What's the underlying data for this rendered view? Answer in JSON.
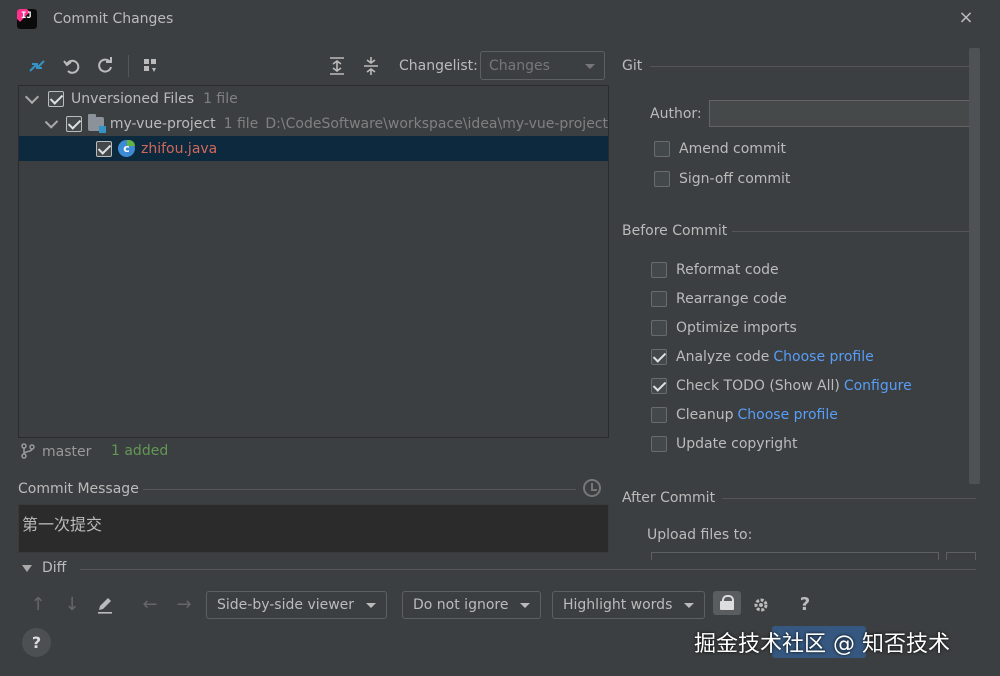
{
  "window": {
    "title": "Commit Changes",
    "close": "×"
  },
  "toolbar": {
    "changelist_label": "Changelist:",
    "changelist_value": "Changes"
  },
  "tree": {
    "root": {
      "label": "Unversioned Files",
      "count": "1 file"
    },
    "folder": {
      "label": "my-vue-project",
      "count": "1 file",
      "path": "D:\\CodeSoftware\\workspace\\idea\\my-vue-project"
    },
    "file": {
      "label": "zhifou.java"
    }
  },
  "status": {
    "branch": "master",
    "added": "1 added"
  },
  "commit": {
    "label": "Commit Message",
    "message": "第一次提交"
  },
  "git": {
    "title": "Git",
    "author_label": "Author:",
    "author_value": "",
    "amend": "Amend commit",
    "signoff": "Sign-off commit"
  },
  "before_commit": {
    "title": "Before Commit",
    "items": [
      {
        "label": "Reformat code",
        "checked": false,
        "link": ""
      },
      {
        "label": "Rearrange code",
        "checked": false,
        "link": ""
      },
      {
        "label": "Optimize imports",
        "checked": false,
        "link": ""
      },
      {
        "label": "Analyze code",
        "checked": true,
        "link": "Choose profile"
      },
      {
        "label": "Check TODO (Show All)",
        "checked": true,
        "link": "Configure"
      },
      {
        "label": "Cleanup",
        "checked": false,
        "link": "Choose profile"
      },
      {
        "label": "Update copyright",
        "checked": false,
        "link": ""
      }
    ]
  },
  "after_commit": {
    "title": "After Commit",
    "upload_label": "Upload files to:"
  },
  "diff": {
    "title": "Diff",
    "viewer": "Side-by-side viewer",
    "ignore": "Do not ignore",
    "highlight": "Highlight words",
    "help": "?"
  },
  "footer": {
    "help": "?"
  },
  "watermark": "掘金技术社区 @ 知否技术",
  "colors": {
    "accent": "#589df6",
    "selection": "#0d293e",
    "added": "#629755",
    "unversioned": "#d1675a"
  }
}
